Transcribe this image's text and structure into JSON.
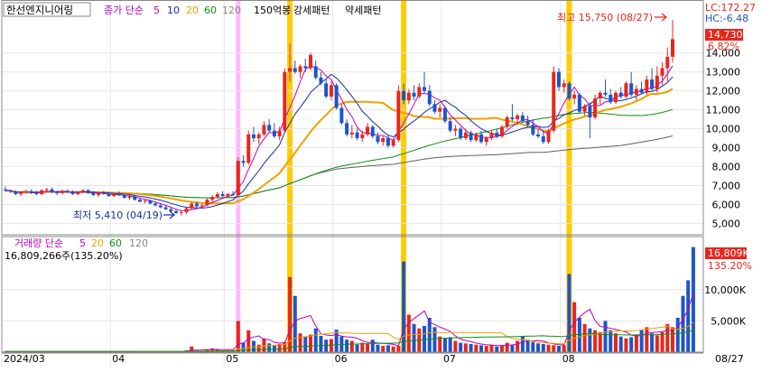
{
  "header": {
    "stock_name": "한선엔지니어링",
    "indicator": "종가 단순",
    "ma_periods": [
      "5",
      "10",
      "20",
      "60",
      "120"
    ],
    "pattern_legend": [
      "150억봉",
      "강세패턴",
      "약세패턴"
    ]
  },
  "volume_header": {
    "label": "거래량 단순",
    "ma_periods": [
      "5",
      "20",
      "60",
      "120"
    ],
    "current_volume_text": "16,809,266주(135.20%)"
  },
  "readouts": {
    "lc": "LC:172.27",
    "hc": "HC:-6.48",
    "price_badge": "14,730",
    "change_badge": "6.82%",
    "volume_badge": "16,809K",
    "volume_pct_badge": "135.20%"
  },
  "annotations": {
    "high": "최고 15,750 (08/27)",
    "low": "최저 5,410 (04/19)"
  },
  "colors": {
    "up": "#e8261c",
    "down": "#1f54c9",
    "ma5": "#c000c0",
    "ma10": "#1030a0",
    "ma20": "#f0a000",
    "ma60": "#109010",
    "ma120": "#606060",
    "highlight_bar": "#ffcc00",
    "highlight_pink": "#ffb8ff"
  },
  "chart_data": [
    {
      "type": "candlestick",
      "title": "한선엔지니어링",
      "ylim": [
        4400,
        16800
      ],
      "y_ticks": [
        "5,000",
        "6,000",
        "7,000",
        "8,000",
        "9,000",
        "10,000",
        "11,000",
        "12,000",
        "13,000",
        "14,000"
      ],
      "x_tick_labels": [
        "2024/03",
        "04",
        "05",
        "06",
        "07",
        "08",
        "08/27"
      ],
      "candles": [
        {
          "o": 6800,
          "h": 6950,
          "l": 6650,
          "c": 6750
        },
        {
          "o": 6750,
          "h": 6800,
          "l": 6600,
          "c": 6680
        },
        {
          "o": 6680,
          "h": 6750,
          "l": 6500,
          "c": 6550
        },
        {
          "o": 6550,
          "h": 6700,
          "l": 6450,
          "c": 6620
        },
        {
          "o": 6620,
          "h": 6780,
          "l": 6550,
          "c": 6700
        },
        {
          "o": 6700,
          "h": 6800,
          "l": 6550,
          "c": 6600
        },
        {
          "o": 6600,
          "h": 6720,
          "l": 6480,
          "c": 6550
        },
        {
          "o": 6550,
          "h": 6800,
          "l": 6500,
          "c": 6750
        },
        {
          "o": 6750,
          "h": 6880,
          "l": 6650,
          "c": 6800
        },
        {
          "o": 6800,
          "h": 6900,
          "l": 6600,
          "c": 6650
        },
        {
          "o": 6650,
          "h": 6750,
          "l": 6500,
          "c": 6600
        },
        {
          "o": 6600,
          "h": 6780,
          "l": 6550,
          "c": 6720
        },
        {
          "o": 6720,
          "h": 6800,
          "l": 6600,
          "c": 6650
        },
        {
          "o": 6650,
          "h": 6750,
          "l": 6500,
          "c": 6550
        },
        {
          "o": 6550,
          "h": 6700,
          "l": 6480,
          "c": 6650
        },
        {
          "o": 6650,
          "h": 6800,
          "l": 6600,
          "c": 6750
        },
        {
          "o": 6750,
          "h": 6820,
          "l": 6550,
          "c": 6600
        },
        {
          "o": 6600,
          "h": 6700,
          "l": 6450,
          "c": 6500
        },
        {
          "o": 6500,
          "h": 6650,
          "l": 6400,
          "c": 6600
        },
        {
          "o": 6600,
          "h": 6720,
          "l": 6500,
          "c": 6550
        },
        {
          "o": 6550,
          "h": 6650,
          "l": 6400,
          "c": 6450
        },
        {
          "o": 6450,
          "h": 6600,
          "l": 6380,
          "c": 6550
        },
        {
          "o": 6550,
          "h": 6680,
          "l": 6450,
          "c": 6480
        },
        {
          "o": 6480,
          "h": 6550,
          "l": 6300,
          "c": 6350
        },
        {
          "o": 6350,
          "h": 6500,
          "l": 6250,
          "c": 6420
        },
        {
          "o": 6420,
          "h": 6480,
          "l": 6200,
          "c": 6250
        },
        {
          "o": 6250,
          "h": 6350,
          "l": 6100,
          "c": 6150
        },
        {
          "o": 6150,
          "h": 6280,
          "l": 6050,
          "c": 6200
        },
        {
          "o": 6200,
          "h": 6250,
          "l": 6000,
          "c": 6050
        },
        {
          "o": 6050,
          "h": 6150,
          "l": 5900,
          "c": 5950
        },
        {
          "o": 5950,
          "h": 6050,
          "l": 5800,
          "c": 5850
        },
        {
          "o": 5850,
          "h": 5950,
          "l": 5700,
          "c": 5750
        },
        {
          "o": 5750,
          "h": 5850,
          "l": 5600,
          "c": 5650
        },
        {
          "o": 5650,
          "h": 5750,
          "l": 5500,
          "c": 5550
        },
        {
          "o": 5550,
          "h": 5700,
          "l": 5410,
          "c": 5600
        },
        {
          "o": 5600,
          "h": 5850,
          "l": 5500,
          "c": 5800
        },
        {
          "o": 5800,
          "h": 6100,
          "l": 5700,
          "c": 6050
        },
        {
          "o": 6050,
          "h": 6150,
          "l": 5850,
          "c": 5900
        },
        {
          "o": 5900,
          "h": 6050,
          "l": 5800,
          "c": 5950
        },
        {
          "o": 5950,
          "h": 6300,
          "l": 5900,
          "c": 6250
        },
        {
          "o": 6250,
          "h": 6500,
          "l": 6150,
          "c": 6400
        },
        {
          "o": 6400,
          "h": 6650,
          "l": 6300,
          "c": 6550
        },
        {
          "o": 6550,
          "h": 6700,
          "l": 6400,
          "c": 6450
        },
        {
          "o": 6450,
          "h": 6600,
          "l": 6350,
          "c": 6550
        },
        {
          "o": 6550,
          "h": 6700,
          "l": 6450,
          "c": 6500
        },
        {
          "o": 6500,
          "h": 8500,
          "l": 6450,
          "c": 8300
        },
        {
          "o": 8300,
          "h": 8600,
          "l": 8000,
          "c": 8200
        },
        {
          "o": 8200,
          "h": 9900,
          "l": 8100,
          "c": 9700
        },
        {
          "o": 9700,
          "h": 10100,
          "l": 9300,
          "c": 9500
        },
        {
          "o": 9500,
          "h": 9800,
          "l": 9200,
          "c": 9700
        },
        {
          "o": 9700,
          "h": 10400,
          "l": 9600,
          "c": 10200
        },
        {
          "o": 10200,
          "h": 10500,
          "l": 9800,
          "c": 9900
        },
        {
          "o": 9900,
          "h": 10300,
          "l": 9500,
          "c": 9600
        },
        {
          "o": 9600,
          "h": 10100,
          "l": 9400,
          "c": 9900
        },
        {
          "o": 9900,
          "h": 13200,
          "l": 9800,
          "c": 13000
        },
        {
          "o": 13000,
          "h": 14500,
          "l": 12500,
          "c": 13200
        },
        {
          "o": 13200,
          "h": 13600,
          "l": 12900,
          "c": 13000
        },
        {
          "o": 13000,
          "h": 13400,
          "l": 12700,
          "c": 13300
        },
        {
          "o": 13300,
          "h": 13700,
          "l": 13000,
          "c": 13200
        },
        {
          "o": 13200,
          "h": 14000,
          "l": 13100,
          "c": 13900
        },
        {
          "o": 13300,
          "h": 13600,
          "l": 12600,
          "c": 12700
        },
        {
          "o": 12700,
          "h": 13000,
          "l": 12300,
          "c": 12400
        },
        {
          "o": 12400,
          "h": 12600,
          "l": 11600,
          "c": 11700
        },
        {
          "o": 11700,
          "h": 12500,
          "l": 11500,
          "c": 12300
        },
        {
          "o": 12300,
          "h": 12400,
          "l": 11000,
          "c": 11100
        },
        {
          "o": 11100,
          "h": 11300,
          "l": 10200,
          "c": 10300
        },
        {
          "o": 10300,
          "h": 10500,
          "l": 9600,
          "c": 9700
        },
        {
          "o": 9700,
          "h": 10200,
          "l": 9500,
          "c": 9800
        },
        {
          "o": 9800,
          "h": 10000,
          "l": 9400,
          "c": 9500
        },
        {
          "o": 9500,
          "h": 9900,
          "l": 9300,
          "c": 9700
        },
        {
          "o": 9700,
          "h": 10300,
          "l": 9600,
          "c": 10100
        },
        {
          "o": 10100,
          "h": 10200,
          "l": 9500,
          "c": 9600
        },
        {
          "o": 9600,
          "h": 9800,
          "l": 9200,
          "c": 9300
        },
        {
          "o": 9300,
          "h": 9600,
          "l": 9100,
          "c": 9500
        },
        {
          "o": 9500,
          "h": 9700,
          "l": 9000,
          "c": 9100
        },
        {
          "o": 9100,
          "h": 9500,
          "l": 9000,
          "c": 9400
        },
        {
          "o": 9400,
          "h": 12300,
          "l": 9300,
          "c": 12000
        },
        {
          "o": 12000,
          "h": 12400,
          "l": 11300,
          "c": 11500
        },
        {
          "o": 11500,
          "h": 12100,
          "l": 11300,
          "c": 11900
        },
        {
          "o": 11900,
          "h": 12300,
          "l": 11500,
          "c": 11700
        },
        {
          "o": 11700,
          "h": 12400,
          "l": 11600,
          "c": 12200
        },
        {
          "o": 12200,
          "h": 13000,
          "l": 11900,
          "c": 12000
        },
        {
          "o": 12000,
          "h": 12300,
          "l": 11200,
          "c": 11300
        },
        {
          "o": 11300,
          "h": 11500,
          "l": 10800,
          "c": 10900
        },
        {
          "o": 10900,
          "h": 11300,
          "l": 10600,
          "c": 11100
        },
        {
          "o": 11100,
          "h": 11200,
          "l": 10300,
          "c": 10400
        },
        {
          "o": 10400,
          "h": 10600,
          "l": 9800,
          "c": 9900
        },
        {
          "o": 9900,
          "h": 10200,
          "l": 9600,
          "c": 10000
        },
        {
          "o": 10000,
          "h": 10100,
          "l": 9400,
          "c": 9500
        },
        {
          "o": 9500,
          "h": 10000,
          "l": 9400,
          "c": 9800
        },
        {
          "o": 9800,
          "h": 9900,
          "l": 9300,
          "c": 9400
        },
        {
          "o": 9400,
          "h": 9800,
          "l": 9300,
          "c": 9700
        },
        {
          "o": 9700,
          "h": 9900,
          "l": 9200,
          "c": 9300
        },
        {
          "o": 9300,
          "h": 9600,
          "l": 9100,
          "c": 9500
        },
        {
          "o": 9500,
          "h": 9900,
          "l": 9400,
          "c": 9800
        },
        {
          "o": 9800,
          "h": 10000,
          "l": 9500,
          "c": 9600
        },
        {
          "o": 9600,
          "h": 10200,
          "l": 9500,
          "c": 10100
        },
        {
          "o": 10100,
          "h": 10700,
          "l": 10000,
          "c": 10600
        },
        {
          "o": 10600,
          "h": 11300,
          "l": 10400,
          "c": 10500
        },
        {
          "o": 10500,
          "h": 10800,
          "l": 10200,
          "c": 10700
        },
        {
          "o": 10700,
          "h": 10900,
          "l": 10300,
          "c": 10400
        },
        {
          "o": 10400,
          "h": 10700,
          "l": 10100,
          "c": 10200
        },
        {
          "o": 10200,
          "h": 10500,
          "l": 9600,
          "c": 9700
        },
        {
          "o": 9700,
          "h": 10000,
          "l": 9500,
          "c": 9600
        },
        {
          "o": 9600,
          "h": 9900,
          "l": 9200,
          "c": 9300
        },
        {
          "o": 9300,
          "h": 10000,
          "l": 9200,
          "c": 9900
        },
        {
          "o": 9900,
          "h": 13300,
          "l": 9800,
          "c": 13000
        },
        {
          "o": 13000,
          "h": 13200,
          "l": 12000,
          "c": 12200
        },
        {
          "o": 12200,
          "h": 12600,
          "l": 11900,
          "c": 12400
        },
        {
          "o": 12400,
          "h": 12500,
          "l": 11500,
          "c": 11600
        },
        {
          "o": 11600,
          "h": 12000,
          "l": 11300,
          "c": 11800
        },
        {
          "o": 11800,
          "h": 11900,
          "l": 10800,
          "c": 10900
        },
        {
          "o": 10900,
          "h": 11300,
          "l": 10700,
          "c": 11200
        },
        {
          "o": 11200,
          "h": 11400,
          "l": 9500,
          "c": 10600
        },
        {
          "o": 10600,
          "h": 11800,
          "l": 10500,
          "c": 11600
        },
        {
          "o": 11600,
          "h": 12000,
          "l": 11300,
          "c": 11900
        },
        {
          "o": 11900,
          "h": 12600,
          "l": 11700,
          "c": 11800
        },
        {
          "o": 11800,
          "h": 12100,
          "l": 11300,
          "c": 11400
        },
        {
          "o": 11400,
          "h": 12000,
          "l": 11300,
          "c": 11900
        },
        {
          "o": 11900,
          "h": 12200,
          "l": 11600,
          "c": 11700
        },
        {
          "o": 11700,
          "h": 12500,
          "l": 11600,
          "c": 12400
        },
        {
          "o": 12400,
          "h": 13000,
          "l": 11700,
          "c": 11800
        },
        {
          "o": 11800,
          "h": 12300,
          "l": 11500,
          "c": 12100
        },
        {
          "o": 12100,
          "h": 12500,
          "l": 11800,
          "c": 11900
        },
        {
          "o": 11900,
          "h": 12800,
          "l": 11800,
          "c": 12600
        },
        {
          "o": 12600,
          "h": 13200,
          "l": 12000,
          "c": 12100
        },
        {
          "o": 12100,
          "h": 13300,
          "l": 11900,
          "c": 12800
        },
        {
          "o": 12800,
          "h": 13500,
          "l": 12300,
          "c": 13200
        },
        {
          "o": 13200,
          "h": 14300,
          "l": 12500,
          "c": 13800
        },
        {
          "o": 13800,
          "h": 15750,
          "l": 13500,
          "c": 14730
        }
      ],
      "highlight_indices": [
        55,
        77,
        109
      ],
      "pink_highlight_index": 45,
      "high_index": 133,
      "low_index": 34
    },
    {
      "type": "bar",
      "title": "거래량",
      "ylim": [
        0,
        18500
      ],
      "y_ticks": [
        "5,000K",
        "10,000K"
      ],
      "values": [
        120,
        100,
        90,
        110,
        130,
        90,
        80,
        160,
        140,
        100,
        90,
        110,
        100,
        90,
        120,
        140,
        100,
        90,
        130,
        100,
        90,
        110,
        100,
        90,
        80,
        90,
        100,
        80,
        90,
        70,
        100,
        90,
        110,
        90,
        120,
        300,
        900,
        250,
        200,
        400,
        600,
        500,
        250,
        300,
        280,
        5000,
        1500,
        3500,
        1800,
        1200,
        2200,
        1400,
        1100,
        1300,
        1600,
        12000,
        9000,
        3000,
        2500,
        2800,
        3800,
        2600,
        2000,
        2100,
        3600,
        2500,
        2000,
        1800,
        1200,
        1500,
        1400,
        2000,
        1200,
        1000,
        1100,
        900,
        1000,
        14500,
        6000,
        4500,
        3800,
        4200,
        5500,
        4000,
        2500,
        2200,
        2400,
        1800,
        1500,
        1400,
        1300,
        1200,
        1100,
        1000,
        1100,
        900,
        1100,
        1500,
        1200,
        1800,
        2500,
        2000,
        1600,
        1400,
        1300,
        1200,
        1100,
        1000,
        1100,
        12500,
        8000,
        5500,
        4500,
        3800,
        3500,
        3200,
        5000,
        3500,
        3000,
        2500,
        2200,
        2400,
        2800,
        3500,
        4000,
        3000,
        2700,
        3200,
        4500,
        4000,
        5500,
        9000,
        11500,
        16809
      ],
      "current_value": 16809
    }
  ]
}
